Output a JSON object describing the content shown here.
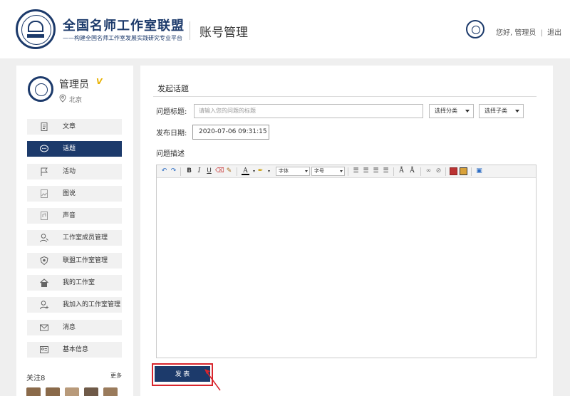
{
  "header": {
    "brand_title": "全国名师工作室联盟",
    "brand_subtitle": "——构建全国名师工作室发展实践研究专业平台",
    "page_title": "账号管理",
    "greeting": "您好,",
    "username": "管理员",
    "logout": "退出"
  },
  "sidebar": {
    "name": "管理员",
    "badge": "V",
    "location": "北京",
    "menu": [
      {
        "label": "文章",
        "icon": "document-icon"
      },
      {
        "label": "话题",
        "icon": "chat-bubble-icon"
      },
      {
        "label": "活动",
        "icon": "flag-icon"
      },
      {
        "label": "图说",
        "icon": "image-icon"
      },
      {
        "label": "声音",
        "icon": "audio-file-icon"
      },
      {
        "label": "工作室成员管理",
        "icon": "user-icon"
      },
      {
        "label": "联盟工作室管理",
        "icon": "shield-icon"
      },
      {
        "label": "我的工作室",
        "icon": "home-icon"
      },
      {
        "label": "我加入的工作室管理",
        "icon": "user-add-icon"
      },
      {
        "label": "消息",
        "icon": "mail-icon"
      },
      {
        "label": "基本信息",
        "icon": "id-card-icon"
      }
    ],
    "active_index": 1,
    "follow_label": "关注8",
    "more_label": "更多"
  },
  "form": {
    "section_title": "发起话题",
    "title_label": "问题标题:",
    "title_placeholder": "请输入您的问题的标题",
    "category_select": "选择分类",
    "subcategory_select": "选择子类",
    "date_label": "发布日期:",
    "date_value": "2020-07-06 09:31:15",
    "desc_label": "问题描述",
    "font_family_select": "字体",
    "font_size_select": "字号",
    "submit_label": "发 表"
  },
  "colors": {
    "brand": "#1c3a6b",
    "highlight": "#d8252c",
    "badge": "#e8b100"
  }
}
